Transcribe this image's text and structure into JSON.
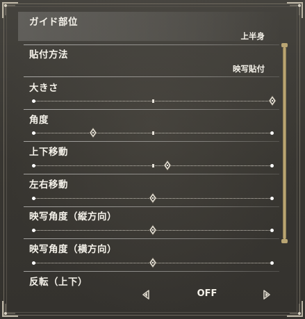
{
  "settings": {
    "guide_part": {
      "label": "ガイド部位",
      "value": "上半身"
    },
    "paste_method": {
      "label": "貼付方法",
      "value": "映写貼付"
    },
    "size": {
      "label": "大きさ",
      "level": 1.0
    },
    "angle": {
      "label": "角度",
      "level": 0.25
    },
    "vertical_move": {
      "label": "上下移動",
      "level": 0.56
    },
    "horizontal_move": {
      "label": "左右移動",
      "level": 0.5
    },
    "projection_angle_v": {
      "label": "映写角度（縦方向）",
      "level": 0.5
    },
    "projection_angle_h": {
      "label": "映写角度（横方向）",
      "level": 0.5
    },
    "flip_vertical": {
      "label": "反転（上下）",
      "value": "OFF"
    }
  },
  "scroll": {
    "position": 0.0,
    "visible_fraction": 0.85
  },
  "colors": {
    "accent_gold": "#c8b27a",
    "text": "#f5f2ea",
    "background": "#3a3833"
  },
  "icons": {
    "left_arrow": "triangle-left-icon",
    "right_arrow": "triangle-right-icon",
    "slider_knob": "diamond-knob-icon"
  }
}
